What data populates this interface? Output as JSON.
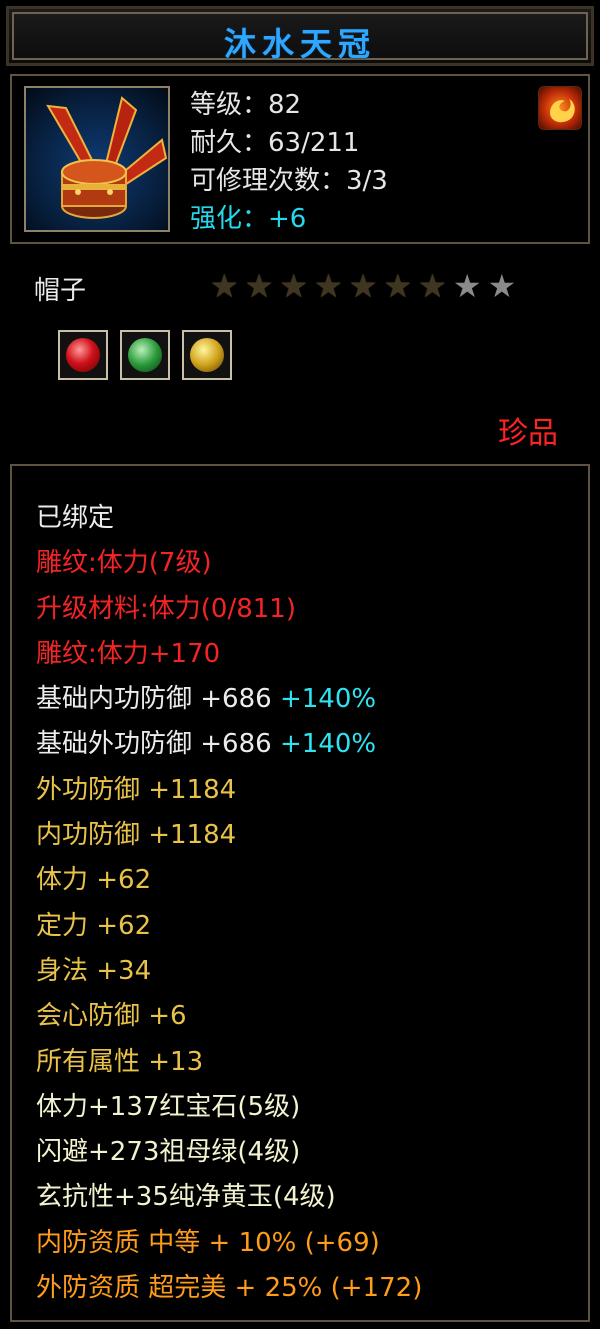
{
  "title": "沐水天冠",
  "header": {
    "level": "等级：82",
    "durability": "耐久：63/211",
    "repairs": "可修理次数：3/3",
    "enhance": "强化：+6"
  },
  "item_type": "帽子",
  "stars": {
    "filled": 7,
    "total": 9
  },
  "gems": [
    "red-gem-icon",
    "green-gem-icon",
    "yellow-gem-icon"
  ],
  "rarity": "珍品",
  "properties": [
    {
      "text": "已绑定",
      "color": "white"
    },
    {
      "text": "雕纹:体力(7级)",
      "color": "red"
    },
    {
      "text": "升级材料:体力(0/811)",
      "color": "red"
    },
    {
      "text": "雕纹:体力+170",
      "color": "red"
    },
    {
      "text": "基础内功防御 +686",
      "extra": "+140%",
      "color": "white"
    },
    {
      "text": "基础外功防御 +686",
      "extra": "+140%",
      "color": "white"
    },
    {
      "text": "外功防御 +1184",
      "color": "yellow"
    },
    {
      "text": "内功防御 +1184",
      "color": "yellow"
    },
    {
      "text": "体力 +62",
      "color": "yellow"
    },
    {
      "text": "定力 +62",
      "color": "yellow"
    },
    {
      "text": "身法 +34",
      "color": "yellow"
    },
    {
      "text": "会心防御 +6",
      "color": "yellow"
    },
    {
      "text": "所有属性 +13",
      "color": "yellow"
    },
    {
      "text": "体力+137红宝石(5级)",
      "color": "bright"
    },
    {
      "text": "闪避+273祖母绿(4级)",
      "color": "bright"
    },
    {
      "text": "玄抗性+35纯净黄玉(4级)",
      "color": "bright"
    },
    {
      "text": "内防资质 中等 + 10% (+69)",
      "color": "orange"
    },
    {
      "text": "外防资质 超完美 + 25% (+172)",
      "color": "orange"
    }
  ],
  "colors": {
    "title": "#2fa7ff",
    "red": "#f22424",
    "yellow": "#e9c24a",
    "orange": "#ff9c1a",
    "cyan": "#2ee3f2"
  }
}
